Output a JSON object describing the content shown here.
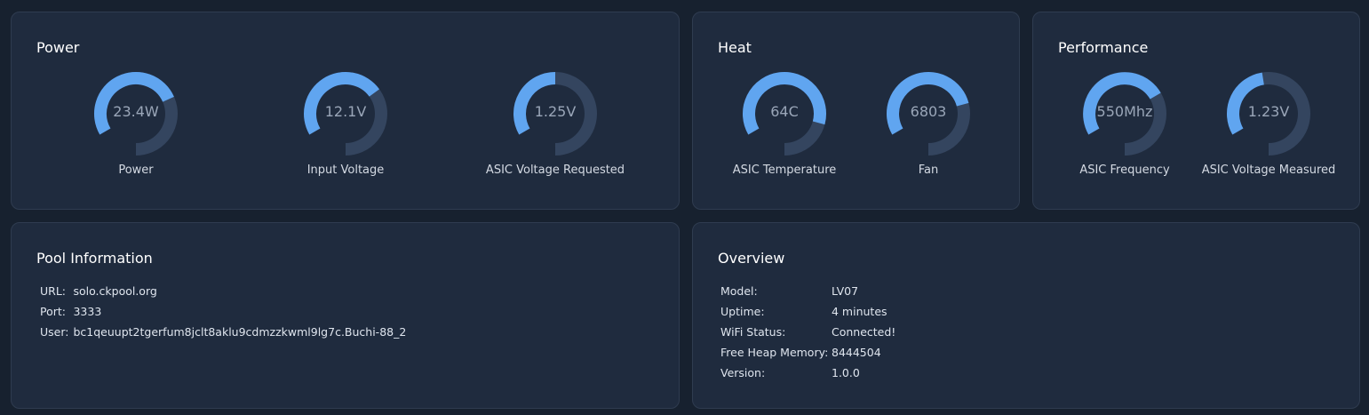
{
  "colors": {
    "background": "#17212f",
    "card": "#1f2b3e",
    "gauge_fill": "#60a5f0",
    "gauge_track": "#34455f"
  },
  "power": {
    "title": "Power",
    "gauges": [
      {
        "value": "23.4W",
        "label": "Power",
        "fraction": 0.62
      },
      {
        "value": "12.1V",
        "label": "Input Voltage",
        "fraction": 0.58
      },
      {
        "value": "1.25V",
        "label": "ASIC Voltage Requested",
        "fraction": 0.4
      }
    ]
  },
  "heat": {
    "title": "Heat",
    "gauges": [
      {
        "value": "64C",
        "label": "ASIC Temperature",
        "fraction": 0.75
      },
      {
        "value": "6803",
        "label": "Fan",
        "fraction": 0.65
      }
    ]
  },
  "performance": {
    "title": "Performance",
    "gauges": [
      {
        "value": "550Mhz",
        "label": "ASIC Frequency",
        "fraction": 0.6
      },
      {
        "value": "1.23V",
        "label": "ASIC Voltage Measured",
        "fraction": 0.37
      }
    ]
  },
  "pool": {
    "title": "Pool Information",
    "rows": [
      {
        "key": "URL:",
        "value": "solo.ckpool.org"
      },
      {
        "key": "Port:",
        "value": "3333"
      },
      {
        "key": "User:",
        "value": "bc1qeuupt2tgerfum8jclt8aklu9cdmzzkwml9lg7c.Buchi-88_2"
      }
    ]
  },
  "overview": {
    "title": "Overview",
    "rows": [
      {
        "key": "Model:",
        "value": "LV07"
      },
      {
        "key": "Uptime:",
        "value": "4 minutes"
      },
      {
        "key": "WiFi Status:",
        "value": "Connected!"
      },
      {
        "key": "Free Heap Memory:",
        "value": "8444504"
      },
      {
        "key": "Version:",
        "value": "1.0.0"
      }
    ]
  }
}
